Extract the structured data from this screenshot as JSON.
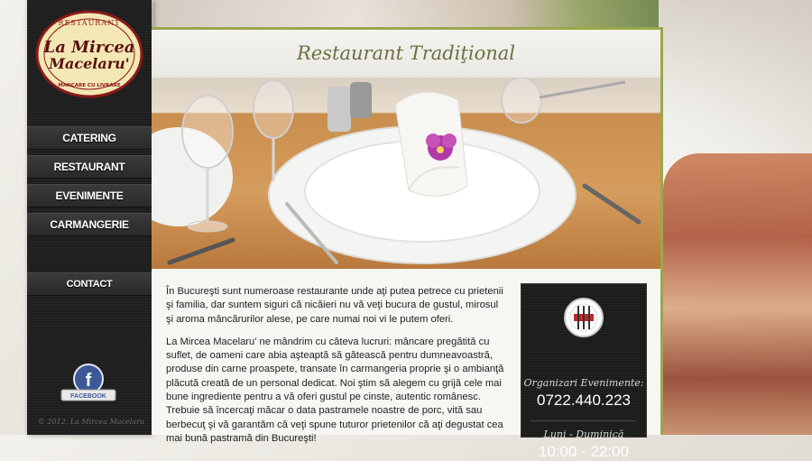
{
  "sidebar": {
    "logo": {
      "top_text": "RESTAURANT",
      "name_line1": "La Mircea",
      "name_line2": "Macelaru'",
      "bottom_text": "MANCARE CU LIVRARE"
    },
    "nav": [
      {
        "label": "Catering"
      },
      {
        "label": "Restaurant"
      },
      {
        "label": "Evenimente"
      },
      {
        "label": "Carmangerie"
      }
    ],
    "contact_label": "Contact",
    "facebook_label": "FACEBOOK",
    "copyright": "© 2012, La Mircea Macelaru"
  },
  "main": {
    "title": "Restaurant Tradiţional",
    "paragraphs": [
      "În Bucureşti sunt numeroase restaurante unde aţi putea petrece cu prietenii şi familia, dar suntem siguri că nicăieri nu vă veţi bucura de gustul, mirosul şi aroma mâncărurilor alese, pe care numai noi vi le putem oferi.",
      "La Mircea Macelaru' ne mândrim cu câteva lucruri: mâncare pregătită cu suflet, de oameni care abia aşteaptă să gătească pentru dumneavoastră, produse din carne proaspete, transate în carmangeria proprie şi o ambianţă plăcută creată de un personal dedicat. Noi ştim să alegem cu grijă cele mai bune ingrediente pentru a vă oferi gustul pe cinste, autentic românesc. Trebuie să încercaţi măcar o data pastramele noastre de porc, vită sau berbecuţ şi vă garantăm că veţi spune tuturor prietenilor că aţi degustat cea mai bună pastramă din Bucureşti!"
    ]
  },
  "info": {
    "events_label": "Organizari Evenimente:",
    "phone": "0722.440.223",
    "days_label": "Luni - Duminică",
    "hours": "10:00 - 22:00"
  },
  "colors": {
    "accent": "#9aa84a",
    "title_text": "#6e7040",
    "sidebar_bg": "#1e1e1e",
    "logo_red": "#8b1a1a",
    "logo_cream": "#f3e7b4",
    "facebook_blue": "#3b5998"
  }
}
